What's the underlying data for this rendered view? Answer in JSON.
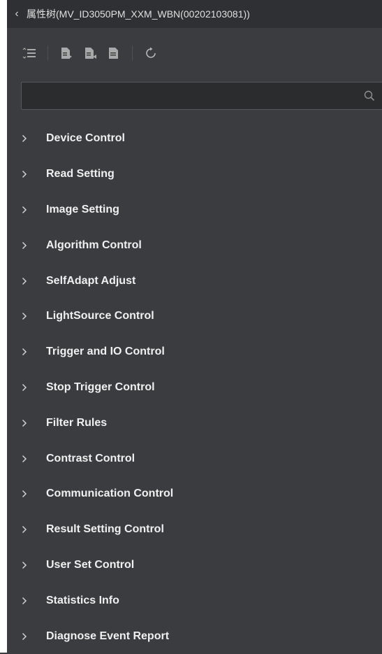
{
  "titlebar": {
    "back_icon": "chevron-left-icon",
    "title": "属性树(MV_ID3050PM_XXM_WBN(00202103081))"
  },
  "toolbar": {
    "buttons": [
      {
        "icon": "expand-collapse-list-icon"
      },
      {
        "icon": "import-file-icon"
      },
      {
        "icon": "export-file-icon"
      },
      {
        "icon": "document-icon"
      },
      {
        "icon": "refresh-icon"
      }
    ]
  },
  "search": {
    "value": "",
    "placeholder": "",
    "icon": "search-icon"
  },
  "tree": {
    "items": [
      {
        "label": "Device Control"
      },
      {
        "label": "Read Setting"
      },
      {
        "label": "Image Setting"
      },
      {
        "label": "Algorithm Control"
      },
      {
        "label": "SelfAdapt Adjust"
      },
      {
        "label": "LightSource Control"
      },
      {
        "label": "Trigger and IO Control"
      },
      {
        "label": "Stop Trigger Control"
      },
      {
        "label": "Filter Rules"
      },
      {
        "label": "Contrast Control"
      },
      {
        "label": "Communication Control"
      },
      {
        "label": "Result Setting Control"
      },
      {
        "label": "User Set Control"
      },
      {
        "label": "Statistics Info"
      },
      {
        "label": "Diagnose Event Report"
      }
    ]
  },
  "colors": {
    "panel_bg": "#3b3c3f",
    "titlebar_bg": "#2f3033",
    "search_bg": "#2b2c2e",
    "text": "#f0f0f0"
  }
}
